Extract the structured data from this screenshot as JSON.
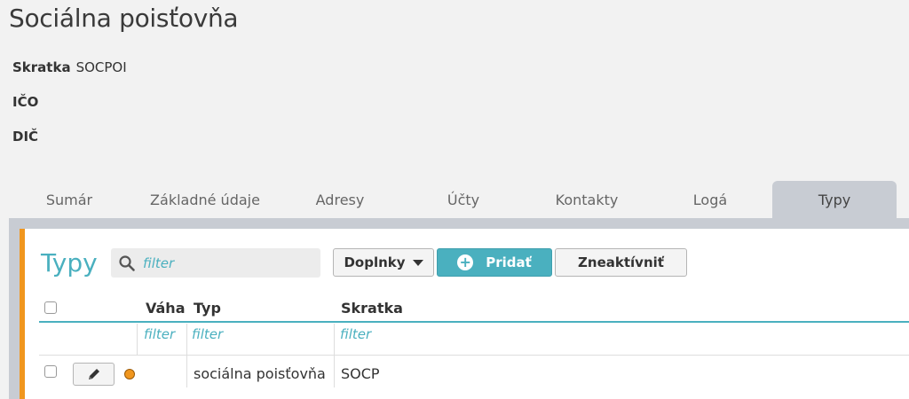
{
  "page": {
    "title": "Sociálna poisťovňa"
  },
  "fields": {
    "skratka_label": "Skratka",
    "skratka_value": "SOCPOI",
    "ico_label": "IČO",
    "dic_label": "DIČ"
  },
  "tabs": [
    {
      "label": "Sumár"
    },
    {
      "label": "Základné údaje"
    },
    {
      "label": "Adresy"
    },
    {
      "label": "Účty"
    },
    {
      "label": "Kontakty"
    },
    {
      "label": "Logá"
    },
    {
      "label": "Typy",
      "active": true
    }
  ],
  "panel": {
    "title": "Typy",
    "search_placeholder": "filter",
    "doplnky_label": "Doplnky",
    "pridat_label": "Pridať",
    "zneaktivnit_label": "Zneaktívniť"
  },
  "table": {
    "columns": [
      "Váha",
      "Typ",
      "Skratka"
    ],
    "filter_placeholders": [
      "filter",
      "filter",
      "filter"
    ],
    "rows": [
      {
        "vaha": "",
        "typ": "sociálna poisťovňa",
        "skratka": "SOCP",
        "status_color": "#f0961e"
      }
    ]
  },
  "colors": {
    "accent": "#4ab0bf",
    "panel_border": "#f0961e",
    "tab_active": "#c8ccd3"
  }
}
